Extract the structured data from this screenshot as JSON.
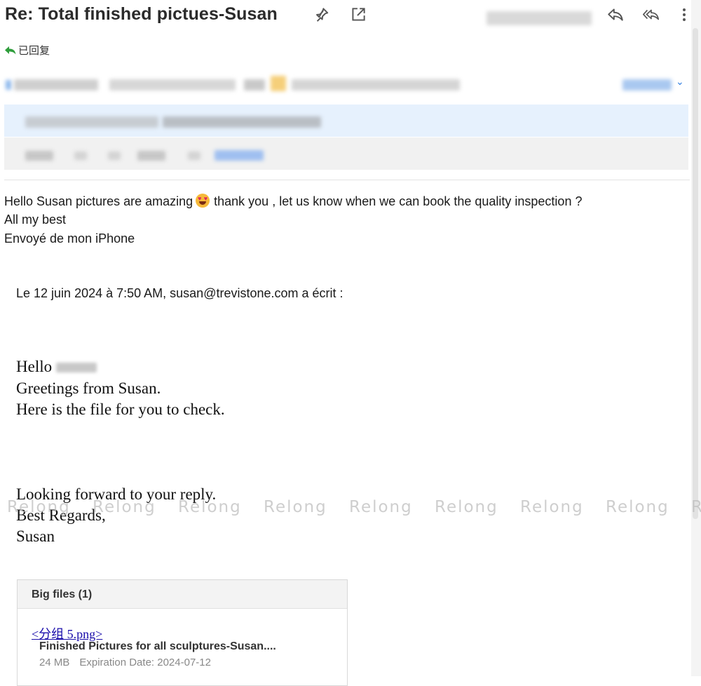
{
  "header": {
    "subject": "Re: Total finished pictues-Susan",
    "replied_label": "已回复"
  },
  "message": {
    "lines": [
      "Hello Susan pictures are amazing",
      "thank you , let us know when we can book the quality inspection ?",
      "All my best",
      "Envoyé de mon iPhone"
    ],
    "quote_header": "Le 12 juin 2024 à 7:50 AM, susan@trevistone.com a écrit :"
  },
  "quoted": {
    "greeting": "Hello",
    "line2": "Greetings from Susan.",
    "line3": " Here is the file for you to check.",
    "line4": "Looking forward to your reply.",
    "line5": "Best Regards,",
    "signature": "Susan"
  },
  "watermark": {
    "items": [
      "Relong",
      "Relong",
      "Relong",
      "Relong",
      "Relong",
      "Relong",
      "Relong",
      "Relong",
      "R"
    ]
  },
  "attachment": {
    "section_title": "Big files (1)",
    "link": "<分组 5.png>",
    "file_name": "Finished Pictures for all sculptures-Susan....",
    "size": "24 MB",
    "expiration": "Expiration Date: 2024-07-12"
  },
  "icons": {
    "pin": "pin-icon",
    "open_external": "open-external-icon",
    "reply": "reply-icon",
    "reply_all": "reply-all-icon",
    "more": "more-vertical-icon",
    "replied": "reply-arrow-icon"
  },
  "colors": {
    "link": "#1a0dab",
    "accent": "#2f7de1",
    "replied_arrow": "#2e9d3b",
    "recipients_bg": "#e6f1fd"
  }
}
